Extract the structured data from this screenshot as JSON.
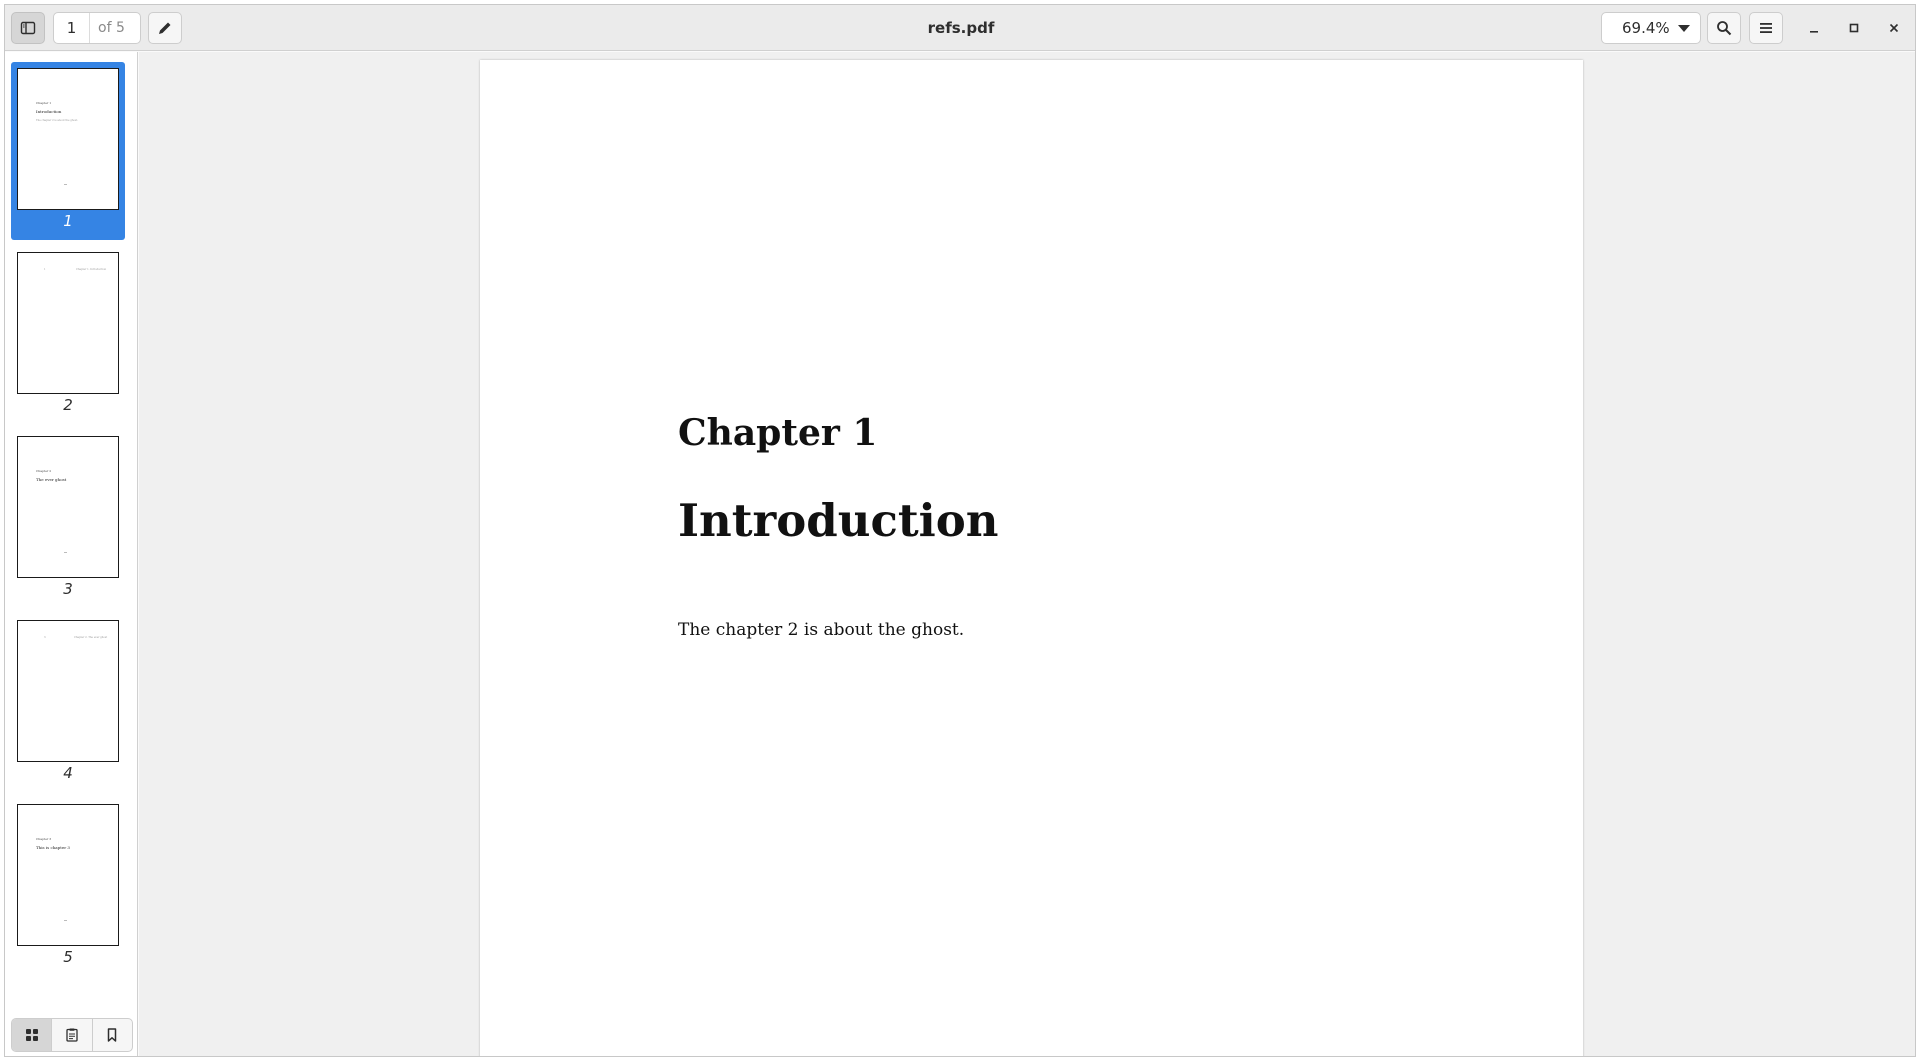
{
  "header": {
    "current_page": "1",
    "page_count_label": "of 5",
    "title": "refs.pdf",
    "zoom": "69.4%"
  },
  "sidebar": {
    "thumbnails": [
      {
        "label": "1",
        "selected": true,
        "lines": [
          "Chapter 1",
          "Introduction",
          "The chapter 2 is about the ghost."
        ]
      },
      {
        "label": "2",
        "selected": false,
        "header": [
          "1",
          "Chapter 1. Introduction"
        ]
      },
      {
        "label": "3",
        "selected": false,
        "lines": [
          "Chapter 2",
          "The ever ghost",
          ""
        ]
      },
      {
        "label": "4",
        "selected": false,
        "header": [
          "3",
          "Chapter 2. The ever ghost"
        ]
      },
      {
        "label": "5",
        "selected": false,
        "lines": [
          "Chapter 3",
          "This is chapter 3",
          ""
        ]
      }
    ],
    "views": [
      "thumbnails-icon",
      "outline-icon",
      "bookmarks-icon"
    ]
  },
  "document": {
    "chapter_number": "Chapter 1",
    "chapter_title": "Introduction",
    "body_text": "The chapter 2 is about the ghost."
  },
  "colors": {
    "accent": "#3584e4",
    "headerbar": "#ebebeb",
    "doc_background": "#f0f0f0"
  }
}
